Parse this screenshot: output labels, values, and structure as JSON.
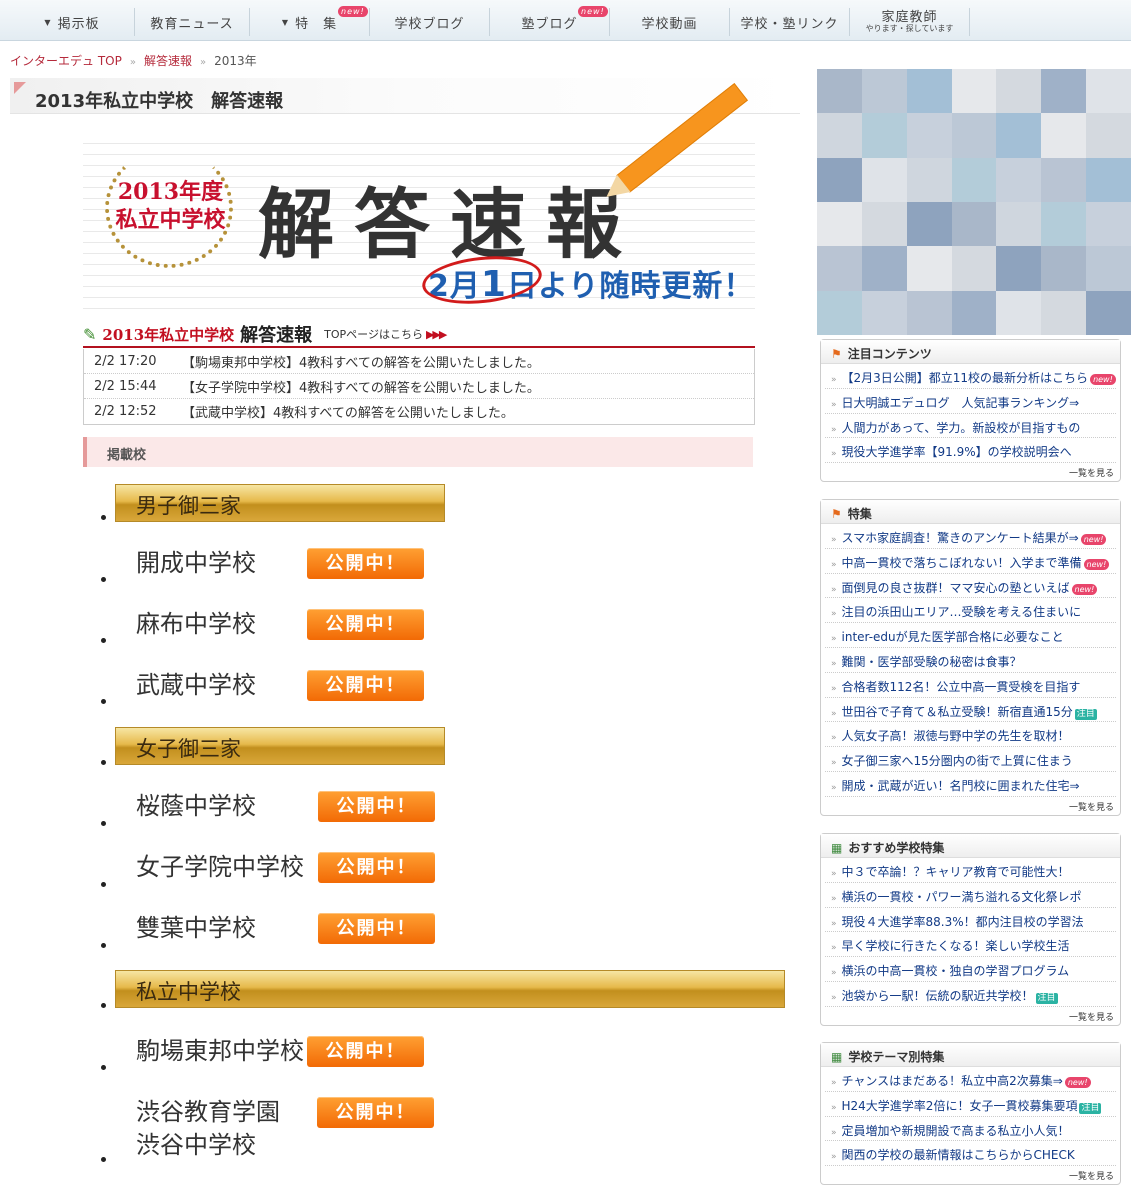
{
  "gnav": {
    "items": [
      {
        "label": "掲示板"
      },
      {
        "label": "教育ニュース"
      },
      {
        "label": "特　集",
        "badge": "new!"
      },
      {
        "label": "学校ブログ"
      },
      {
        "label": "塾ブログ",
        "badge": "new!"
      },
      {
        "label": "学校動画"
      },
      {
        "label": "学校・塾リンク"
      },
      {
        "label": "家庭教師",
        "sub": "やります・探しています"
      }
    ]
  },
  "breadcrumb": {
    "home": "インターエデュ TOP",
    "parent": "解答速報",
    "current": "2013年",
    "sep": "»"
  },
  "page_title": "2013年私立中学校　解答速報",
  "banner": {
    "year": "2013年度",
    "type": "私立中学校",
    "title": "解答速報",
    "update_a": "2月",
    "update_b": "1",
    "update_c": "日より随時更新！"
  },
  "news": {
    "head1": "2013年私立中学校",
    "head2": "解答速報",
    "toplink": "TOPページはこちら",
    "arrows": "▶▶▶",
    "items": [
      {
        "date": "2/2  17:20",
        "text": "【駒場東邦中学校】4教科すべての解答を公開いたしました。"
      },
      {
        "date": "2/2  15:44",
        "text": "【女子学院中学校】4教科すべての解答を公開いたしました。"
      },
      {
        "date": "2/2  12:52",
        "text": "【武蔵中学校】4教科すべての解答を公開いたしました。"
      }
    ]
  },
  "schools_label": "掲載校",
  "open_label": "公開中！",
  "groups": [
    {
      "name": "男子御三家",
      "schools": [
        "開成中学校",
        "麻布中学校",
        "武蔵中学校"
      ]
    },
    {
      "name": "女子御三家",
      "schools": [
        "桜蔭中学校",
        "女子学院中学校",
        "雙葉中学校"
      ]
    },
    {
      "name": "私立中学校",
      "schools": [
        "駒場東邦中学校",
        "渋谷教育学園",
        "渋谷中学校"
      ]
    }
  ],
  "sidebar": {
    "more": "一覧を見る",
    "boxes": [
      {
        "title": "注目コンテンツ",
        "items": [
          {
            "text": "【2月3日公開】都立11校の最新分析はこちら",
            "tag": "new!"
          },
          {
            "text": "日大明誠エデュログ　人気記事ランキング⇒"
          },
          {
            "text": "人間力があって、学力。新設校が目指すもの"
          },
          {
            "text": "現役大学進学率【91.9%】の学校説明会へ"
          }
        ]
      },
      {
        "title": "特集",
        "items": [
          {
            "text": "スマホ家庭調査！驚きのアンケート結果が⇒",
            "tag": "new!"
          },
          {
            "text": "中高一貫校で落ちこぼれない！入学まで準備",
            "tag": "new!"
          },
          {
            "text": "面倒見の良さ抜群！ママ安心の塾といえば",
            "tag": "new!"
          },
          {
            "text": "注目の浜田山エリア…受験を考える住まいに"
          },
          {
            "text": "inter-eduが見た医学部合格に必要なこと"
          },
          {
            "text": "難関・医学部受験の秘密は食事？"
          },
          {
            "text": "合格者数112名！公立中高一貫受検を目指す"
          },
          {
            "text": "世田谷で子育て＆私立受験！新宿直通15分",
            "tag2": "注目"
          },
          {
            "text": "人気女子高！淑徳与野中学の先生を取材！"
          },
          {
            "text": "女子御三家へ15分圏内の街で上質に住まう"
          },
          {
            "text": "開成・武蔵が近い！名門校に囲まれた住宅⇒"
          }
        ]
      },
      {
        "title": "おすすめ学校特集",
        "items": [
          {
            "text": "中３で卒論！？キャリア教育で可能性大！"
          },
          {
            "text": "横浜の一貫校・パワー満ち溢れる文化祭レポ"
          },
          {
            "text": "現役４大進学率88.3%！都内注目校の学習法"
          },
          {
            "text": "早く学校に行きたくなる！楽しい学校生活"
          },
          {
            "text": "横浜の中高一貫校・独自の学習プログラム"
          },
          {
            "text": "池袋から一駅！伝統の駅近共学校！",
            "tag2": "注目"
          }
        ]
      },
      {
        "title": "学校テーマ別特集",
        "items": [
          {
            "text": "チャンスはまだある！私立中高2次募集⇒",
            "tag": "new!"
          },
          {
            "text": "H24大学進学率2倍に！女子一貫校募集要項",
            "tag2": "注目"
          },
          {
            "text": "定員増加や新規開設で高まる私立小人気！"
          },
          {
            "text": "関西の学校の最新情報はこちらからCHECK"
          }
        ]
      }
    ]
  },
  "colors": {
    "accent": "#b52a3b",
    "button": "#f26a05",
    "link": "#123a86",
    "gold": "#d9a73a"
  }
}
